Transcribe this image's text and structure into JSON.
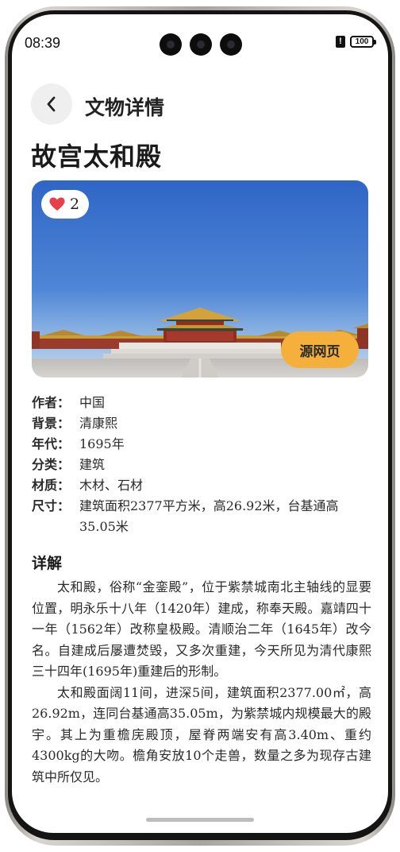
{
  "status": {
    "time": "08:39",
    "alert": "!",
    "battery": "100"
  },
  "header": {
    "back_icon": "chevron-left-icon",
    "title": "文物详情"
  },
  "artifact": {
    "title": "故宫太和殿",
    "likes": "2",
    "like_icon": "heart-icon",
    "source_button": "源网页"
  },
  "info": [
    {
      "key": "作者：",
      "value": "中国"
    },
    {
      "key": "背景：",
      "value": "清康熙"
    },
    {
      "key": "年代：",
      "value": "1695年"
    },
    {
      "key": "分类：",
      "value": "建筑"
    },
    {
      "key": "材质：",
      "value": "木材、石材"
    },
    {
      "key": "尺寸：",
      "value": "建筑面积2377平方米，高26.92米，台基通高35.05米"
    }
  ],
  "detail": {
    "heading": "详解",
    "paragraphs": [
      "太和殿，俗称“金銮殿”，位于紫禁城南北主轴线的显要位置，明永乐十八年（1420年）建成，称奉天殿。嘉靖四十一年（1562年）改称皇极殿。清顺治二年（1645年）改今名。自建成后屡遭焚毁，又多次重建，今天所见为清代康熙三十四年(1695年)重建后的形制。",
      "太和殿面阔11间，进深5间，建筑面积2377.00㎡，高26.92m，连同台基通高35.05m，为紫禁城内规模最大的殿宇。其上为重檐庑殿顶，屋脊两端安有高3.40m、重约4300kg的大吻。檐角安放10个走兽，数量之多为现存古建筑中所仅见。"
    ]
  },
  "colors": {
    "accent": "#f5b03b",
    "heart": "#e8404a",
    "sky_top": "#2f66c6",
    "sky_bottom": "#a9c9ea"
  }
}
